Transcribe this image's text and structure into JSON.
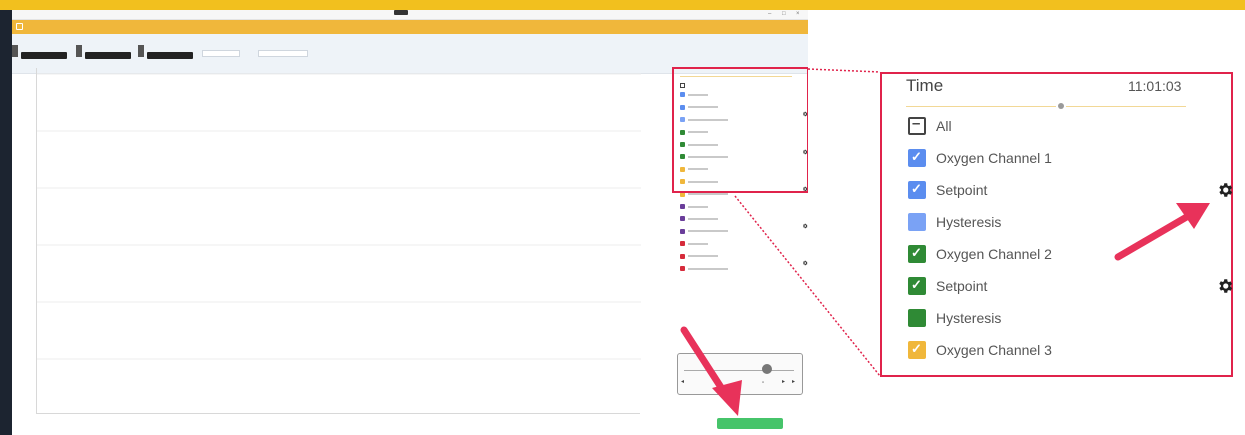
{
  "colors": {
    "banner": "#f2c01e",
    "app_header": "#f0b73b",
    "highlight": "#e0234b",
    "blue": "#5b8def",
    "green": "#2f8a35",
    "orange": "#f0b73b",
    "purple": "#6a3d9a",
    "red": "#d62b3b"
  },
  "callout": {
    "time_label": "Time",
    "time_value": "11:01:03",
    "all_label": "All",
    "items": [
      {
        "label": "Oxygen Channel 1",
        "color": "#5b8def",
        "checked": true,
        "gear": false
      },
      {
        "label": "Setpoint",
        "color": "#5b8def",
        "checked": true,
        "gear": true
      },
      {
        "label": "Hysteresis",
        "color": "#7aa2f5",
        "checked": false,
        "gear": false
      },
      {
        "label": "Oxygen Channel 2",
        "color": "#2f8a35",
        "checked": true,
        "gear": false
      },
      {
        "label": "Setpoint",
        "color": "#2f8a35",
        "checked": true,
        "gear": true
      },
      {
        "label": "Hysteresis",
        "color": "#2f8a35",
        "checked": false,
        "gear": false
      },
      {
        "label": "Oxygen Channel 3",
        "color": "#f0b73b",
        "checked": true,
        "gear": false
      }
    ]
  },
  "small_legend": {
    "swatches": [
      {
        "color": "#5b8def",
        "gear": false
      },
      {
        "color": "#5b8def",
        "gear": true
      },
      {
        "color": "#7aa2f5",
        "gear": false
      },
      {
        "color": "#2f8a35",
        "gear": false
      },
      {
        "color": "#2f8a35",
        "gear": true
      },
      {
        "color": "#2f8a35",
        "gear": false
      },
      {
        "color": "#f0b73b",
        "gear": false
      },
      {
        "color": "#f0b73b",
        "gear": true
      },
      {
        "color": "#f0b73b",
        "gear": false
      },
      {
        "color": "#6a3d9a",
        "gear": false
      },
      {
        "color": "#6a3d9a",
        "gear": true
      },
      {
        "color": "#6a3d9a",
        "gear": false
      },
      {
        "color": "#d62b3b",
        "gear": false
      },
      {
        "color": "#d62b3b",
        "gear": true
      },
      {
        "color": "#d62b3b",
        "gear": false
      }
    ]
  }
}
